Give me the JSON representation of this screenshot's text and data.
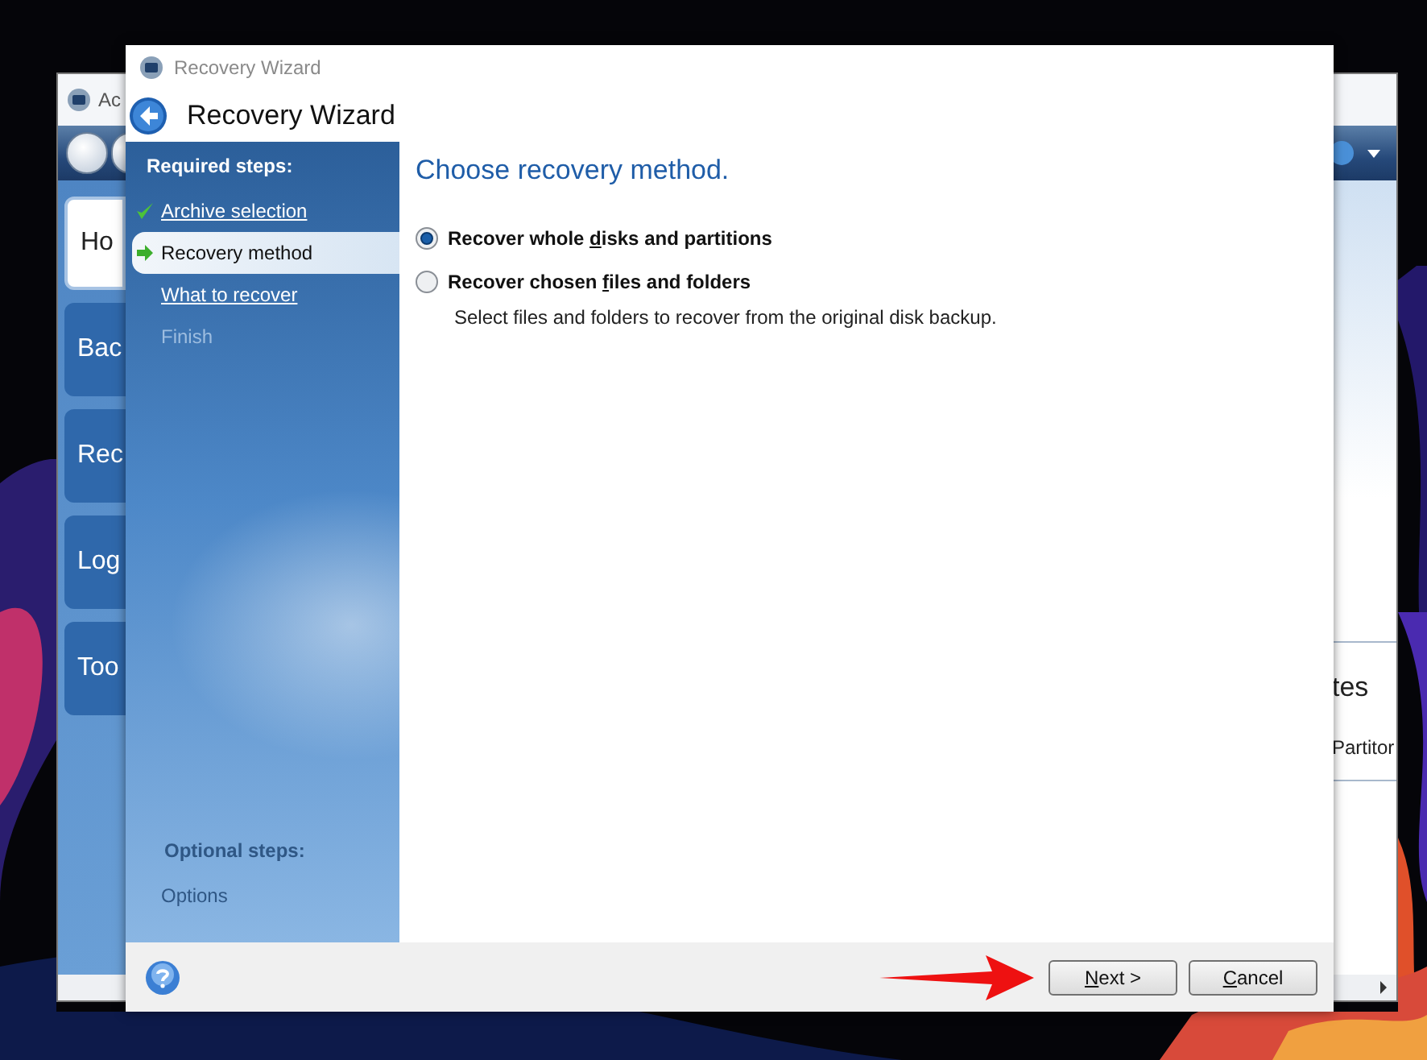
{
  "background_window": {
    "title": "Ac",
    "nav_tiles": [
      {
        "label": "Ho",
        "selected": true
      },
      {
        "label": "Bac",
        "selected": false
      },
      {
        "label": "Rec",
        "selected": false
      },
      {
        "label": "Log",
        "selected": false
      },
      {
        "label": "Too",
        "selected": false
      }
    ],
    "pane_heading": "tes",
    "pane_item": "Partitor"
  },
  "wizard": {
    "title": "Recovery Wizard",
    "header": "Recovery Wizard",
    "sidebar": {
      "heading": "Required steps:",
      "steps": [
        {
          "label": "Archive selection",
          "kind": "done",
          "selected": false
        },
        {
          "label": "Recovery method",
          "kind": "current",
          "selected": true
        },
        {
          "label": "What to recover",
          "kind": "pending",
          "selected": false
        },
        {
          "label": "Finish",
          "kind": "disabled",
          "selected": false
        }
      ],
      "optional_heading": "Optional steps:",
      "optional_steps": [
        {
          "label": "Options",
          "kind": "disabled",
          "selected": false
        }
      ]
    },
    "content": {
      "heading": "Choose recovery method.",
      "options": [
        {
          "label_parts": [
            {
              "text": "Recover whole ",
              "access_key": false
            },
            {
              "text": "d",
              "access_key": true
            },
            {
              "text": "isks and partitions",
              "access_key": false
            }
          ],
          "selected": true
        },
        {
          "label_parts": [
            {
              "text": "Recover chosen ",
              "access_key": false
            },
            {
              "text": "f",
              "access_key": true
            },
            {
              "text": "iles and folders",
              "access_key": false
            }
          ],
          "selected": false,
          "description": "Select files and folders to recover from the original disk backup."
        }
      ]
    },
    "buttons": [
      {
        "label_parts": [
          {
            "text": "N",
            "access_key": true
          },
          {
            "text": "ext >",
            "access_key": false
          }
        ]
      },
      {
        "label_parts": [
          {
            "text": "C",
            "access_key": true
          },
          {
            "text": "ancel",
            "access_key": false
          }
        ]
      }
    ]
  }
}
